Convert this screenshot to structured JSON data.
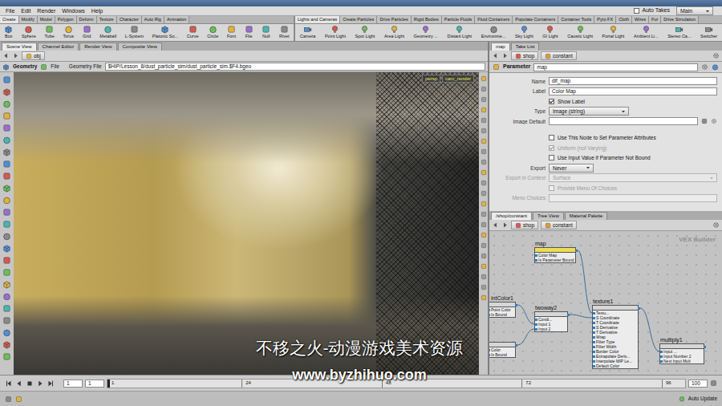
{
  "menu": [
    "File",
    "Edit",
    "Render",
    "Windows",
    "Help"
  ],
  "auto_takes": {
    "label": "Auto Takes",
    "checked": false
  },
  "desktop": "Main",
  "shelf_tabs_left": [
    {
      "label": "Create",
      "selected": true
    },
    {
      "label": "Modify",
      "selected": false
    },
    {
      "label": "Model",
      "selected": false
    },
    {
      "label": "Polygon",
      "selected": false
    },
    {
      "label": "Deform",
      "selected": false
    },
    {
      "label": "Texture",
      "selected": false
    },
    {
      "label": "Character",
      "selected": false
    },
    {
      "label": "Auto Rig",
      "selected": false
    },
    {
      "label": "Animation",
      "selected": false
    }
  ],
  "shelf_tabs_right": [
    {
      "label": "Lights and Cameras",
      "selected": true
    },
    {
      "label": "Create Particles",
      "selected": false
    },
    {
      "label": "Drive Particles",
      "selected": false
    },
    {
      "label": "Rigid Bodies",
      "selected": false
    },
    {
      "label": "Particle Fluids",
      "selected": false
    },
    {
      "label": "Fluid Containers",
      "selected": false
    },
    {
      "label": "Populate Containers",
      "selected": false
    },
    {
      "label": "Container Tools",
      "selected": false
    },
    {
      "label": "Pyro FX",
      "selected": false
    },
    {
      "label": "Cloth",
      "selected": false
    },
    {
      "label": "Wires",
      "selected": false
    },
    {
      "label": "Fur",
      "selected": false
    },
    {
      "label": "Drive Simulation",
      "selected": false
    }
  ],
  "shelf_tools_left": [
    "Box",
    "Sphere",
    "Tube",
    "Torus",
    "Grid",
    "Metaball",
    "L-System",
    "Platonic So...",
    "Curve",
    "Circle",
    "Font",
    "File",
    "Null",
    "Rivet"
  ],
  "shelf_tools_right": [
    "Camera",
    "Point Light",
    "Spot Light",
    "Area Light",
    "Geometry ...",
    "Distant Light",
    "Environme...",
    "Sky Light",
    "GI Light",
    "Caustic Light",
    "Portal Light",
    "Ambient Li...",
    "Stereo Ca...",
    "Switcher"
  ],
  "scene_tabs": [
    {
      "label": "Scene View",
      "selected": true
    },
    {
      "label": "Channel Editor",
      "selected": false
    },
    {
      "label": "Render View",
      "selected": false
    },
    {
      "label": "Composite View",
      "selected": false
    }
  ],
  "scene_path": "obj",
  "geometry_bar": {
    "context": "Geometry",
    "node": "File",
    "label": "Geometry File",
    "value": "$HIP/Lesson_8/dust_particle_sim/dust_particle_sim.$F4.bgeo"
  },
  "viewport_buttons": [
    "persp",
    "cam_render"
  ],
  "param_tabs": [
    {
      "label": "map",
      "selected": true
    },
    {
      "label": "Take List",
      "selected": false
    }
  ],
  "param_path": [
    "shop",
    "constant"
  ],
  "param_header": {
    "type": "Parameter",
    "name": "map"
  },
  "params": [
    {
      "kind": "field",
      "label": "Name",
      "value": "dif_map",
      "disabled": false
    },
    {
      "kind": "field",
      "label": "Label",
      "value": "Color Map",
      "disabled": false
    },
    {
      "kind": "check",
      "label": "Show Label",
      "checked": true,
      "disabled": false
    },
    {
      "kind": "select",
      "label": "Type",
      "value": "Image (string)",
      "disabled": false
    },
    {
      "kind": "field",
      "label": "Image Default",
      "value": "",
      "disabled": false
    },
    {
      "kind": "check",
      "label": "Use This Node to Set Parameter Attributes",
      "checked": false,
      "disabled": false
    },
    {
      "kind": "check",
      "label": "Uniform (not Varying)",
      "checked": true,
      "disabled": true
    },
    {
      "kind": "check",
      "label": "Use Input Value if Parameter Not Bound",
      "checked": false,
      "disabled": false
    },
    {
      "kind": "select",
      "label": "Export",
      "value": "Never",
      "disabled": false
    },
    {
      "kind": "select",
      "label": "Export in Context",
      "value": "Surface",
      "disabled": true
    },
    {
      "kind": "check",
      "label": "Provide Menu Of Choices",
      "checked": false,
      "disabled": true
    },
    {
      "kind": "field",
      "label": "Menu Choices",
      "value": "",
      "disabled": true
    }
  ],
  "network_tabs": [
    {
      "label": "/shop/constant",
      "selected": true
    },
    {
      "label": "Tree View",
      "selected": false
    },
    {
      "label": "Material Palette",
      "selected": false
    }
  ],
  "network_path": [
    "shop",
    "constant"
  ],
  "network_label": "VEX Builder",
  "nodes": [
    {
      "title": "map",
      "color": "#eddc55",
      "inputs": [
        "Color Map",
        "Is Parameter Bound"
      ]
    },
    {
      "title": "intColor1",
      "color": "#d6d6d6",
      "inputs": [
        "Point Color",
        "Is Bound"
      ]
    },
    {
      "title": "twoway2",
      "color": "#d6d6d6",
      "inputs": [
        "Condi...",
        "Input 1",
        "Input 2"
      ]
    },
    {
      "title": "texture1",
      "color": "#d6d6d6",
      "inputs": [
        "Textu...",
        "S Coordinate",
        "T Coordinate",
        "S Derivative",
        "T Derivative",
        "Wrap",
        "Filter Type",
        "Filter Width",
        "Border Color",
        "Extrapolate Deriv...",
        "Interpolate MIP Le...",
        "Default Color"
      ]
    },
    {
      "title": "multiply1",
      "color": "#d6d6d6",
      "inputs": [
        "Input ...",
        "Input Number 2",
        "Next Input Mult"
      ]
    },
    {
      "color": "#d6d6d6",
      "inputs": [
        "Color",
        "Is Bound"
      ]
    }
  ],
  "timeline": {
    "start": "1",
    "current": "1",
    "ticks": [
      "1",
      "24",
      "48",
      "72",
      "96"
    ],
    "end": "100"
  },
  "status": {
    "auto_update": "Auto Update"
  },
  "watermark": [
    "不移之火-动漫游戏美术资源",
    "www.byzhihuo.com"
  ]
}
